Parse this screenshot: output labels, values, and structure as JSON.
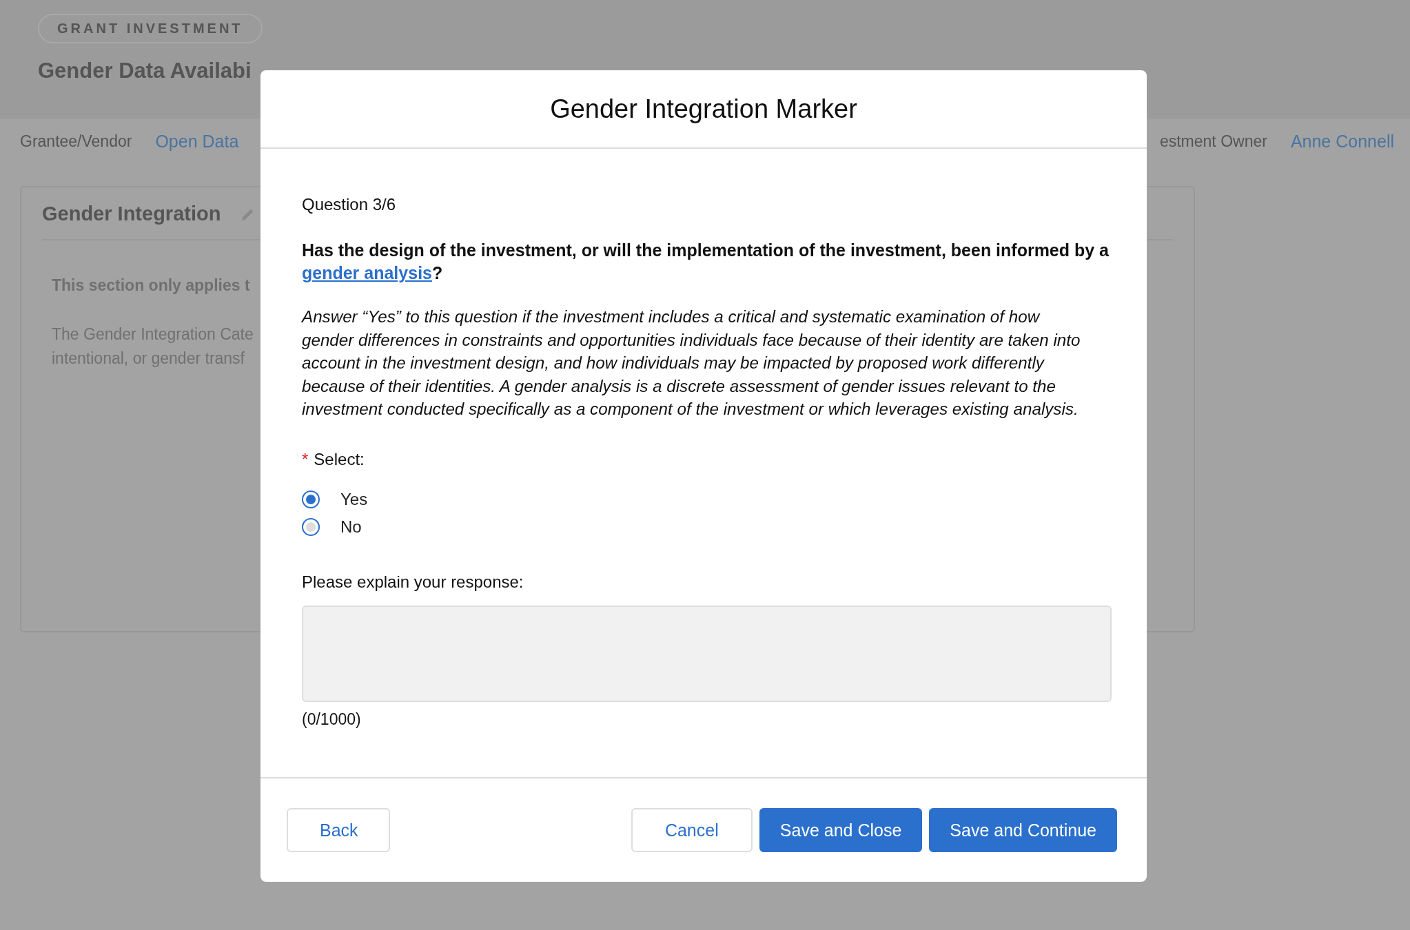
{
  "page": {
    "badge": "GRANT INVESTMENT",
    "title": "Gender Data Availabi",
    "nav_left": [
      {
        "kind": "label",
        "text": "Grantee/Vendor"
      },
      {
        "kind": "link",
        "text": "Open Data"
      }
    ],
    "nav_right": [
      {
        "kind": "label",
        "text": "estment Owner"
      },
      {
        "kind": "link",
        "text": "Anne Connell"
      }
    ],
    "card": {
      "title": "Gender Integration",
      "note": "This section only applies t",
      "lines": [
        "The Gender Integration Cate",
        "intentional, or gender transf"
      ]
    }
  },
  "modal": {
    "title": "Gender Integration Marker",
    "progress": "Question 3/6",
    "question": {
      "text": "Has the design of the investment, or will the implementation of the investment, been informed by a",
      "link": "gender analysis",
      "end": "?"
    },
    "description": "Answer “Yes” to this question if the investment includes a critical and systematic examination of how gender differences in constraints and opportunities individuals face because of their identity are taken into account in the investment design, and how individuals may be impacted by proposed work differently because of their identities. A gender analysis is a discrete assessment of gender issues relevant to the investment conducted specifically as a component of the investment or which leverages existing analysis.",
    "select": {
      "label": "Select:",
      "required": true,
      "required_mark": "*",
      "options": [
        {
          "label": "Yes",
          "selected": true
        },
        {
          "label": "No",
          "selected": false
        }
      ]
    },
    "explain": {
      "label": "Please explain your response:",
      "counter": "(0/1000)"
    },
    "buttons": [
      {
        "label": "Back",
        "kind": "outline"
      },
      {
        "label": "Cancel",
        "kind": "outline"
      },
      {
        "label": "Save and Close",
        "kind": "primary"
      },
      {
        "label": "Save and Continue",
        "kind": "primary"
      }
    ]
  }
}
